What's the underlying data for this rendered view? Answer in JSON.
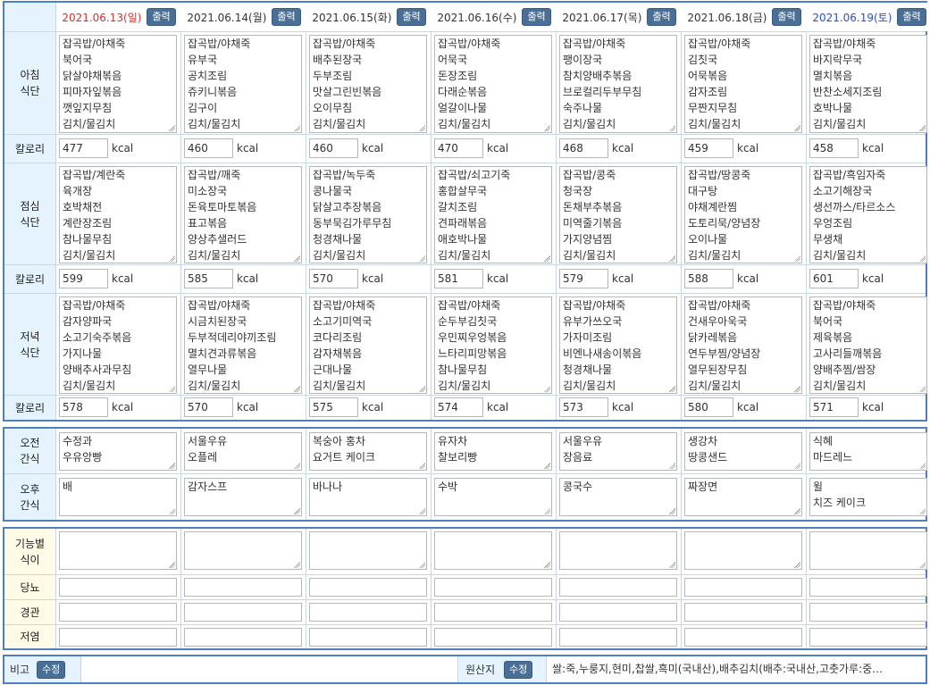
{
  "days": [
    {
      "date": "2021.06.13",
      "dow": "(일)",
      "color": "red",
      "print": "출력",
      "breakfast": "잡곡밥/야채죽\n북어국\n닭살야채볶음\n피마자잎볶음\n깻잎지무침\n김치/물김치",
      "b_kcal": "477",
      "lunch": "잡곡밥/계란죽\n육개장\n호박채전\n계란장조림\n참나물무침\n김치/물김치",
      "l_kcal": "599",
      "dinner": "잡곡밥/야채죽\n감자양파국\n소고기숙주볶음\n가지나물\n양배추사과무침\n김치/물김치",
      "d_kcal": "578",
      "am_snack": "수정과\n우유앙빵",
      "pm_snack": "배"
    },
    {
      "date": "2021.06.14",
      "dow": "(월)",
      "color": "",
      "print": "출력",
      "breakfast": "잡곡밥/야채죽\n유부국\n공치조림\n쥬키니볶음\n김구이\n김치/물김치",
      "b_kcal": "460",
      "lunch": "잡곡밥/깨죽\n미소장국\n돈육토마토볶음\n표고볶음\n양상추샐러드\n김치/물김치",
      "l_kcal": "585",
      "dinner": "잡곡밥/야채죽\n시금치된장국\n두부적데리야끼조림\n멸치견과류볶음\n열무나물\n김치/물김치",
      "d_kcal": "570",
      "am_snack": "서울우유\n오플레",
      "pm_snack": "감자스프"
    },
    {
      "date": "2021.06.15",
      "dow": "(화)",
      "color": "",
      "print": "출력",
      "breakfast": "잡곡밥/야채죽\n배추된장국\n두부조림\n맛살그린빈볶음\n오이무침\n김치/물김치",
      "b_kcal": "460",
      "lunch": "잡곡밥/녹두죽\n콩나물국\n닭살고추장볶음\n동부묵김가루무침\n청경채나물\n김치/물김치",
      "l_kcal": "570",
      "dinner": "잡곡밥/야채죽\n소고기미역국\n코다리조림\n감자채볶음\n근대나물\n김치/물김치",
      "d_kcal": "575",
      "am_snack": "복숭아 홍차\n요거트 케이크",
      "pm_snack": "바나나"
    },
    {
      "date": "2021.06.16",
      "dow": "(수)",
      "color": "",
      "print": "출력",
      "breakfast": "잡곡밥/야채죽\n어묵국\n돈장조림\n다래순볶음\n얼갈이나물\n김치/물김치",
      "b_kcal": "470",
      "lunch": "잡곡밥/쇠고기죽\n홍합살무국\n갈치조림\n견파래볶음\n애호박나물\n김치/물김치",
      "l_kcal": "581",
      "dinner": "잡곡밥/야채죽\n순두부김칫국\n우민찌우엉볶음\n느타리피망볶음\n참나물무침\n김치/물김치",
      "d_kcal": "574",
      "am_snack": "유자차\n찰보리빵",
      "pm_snack": "수박"
    },
    {
      "date": "2021.06.17",
      "dow": "(목)",
      "color": "",
      "print": "출력",
      "breakfast": "잡곡밥/야채죽\n팽이장국\n참치양배추볶음\n브로컬리두부무침\n숙주나물\n김치/물김치",
      "b_kcal": "468",
      "lunch": "잡곡밥/콩죽\n청국장\n돈채부추볶음\n미역줄기볶음\n가지양념찜\n김치/물김치",
      "l_kcal": "579",
      "dinner": "잡곡밥/야채죽\n유부가쓰오국\n가자미조림\n비엔나새송이볶음\n청경채나물\n김치/물김치",
      "d_kcal": "573",
      "am_snack": "서울우유\n장음료",
      "pm_snack": "콩국수"
    },
    {
      "date": "2021.06.18",
      "dow": "(금)",
      "color": "",
      "print": "출력",
      "breakfast": "잡곡밥/야채죽\n김칫국\n어묵볶음\n감자조림\n무짠지무침\n김치/물김치",
      "b_kcal": "459",
      "lunch": "잡곡밥/땅콩죽\n대구탕\n야채계란찜\n도토리묵/양념장\n오이나물\n김치/물김치",
      "l_kcal": "588",
      "dinner": "잡곡밥/야채죽\n건새우아욱국\n닭카레볶음\n연두부찜/양념장\n열무된장무침\n김치/물김치",
      "d_kcal": "580",
      "am_snack": "생강차\n땅콩샌드",
      "pm_snack": "짜장면"
    },
    {
      "date": "2021.06.19",
      "dow": "(토)",
      "color": "blue",
      "print": "출력",
      "breakfast": "잡곡밥/야채죽\n바지락무국\n멸치볶음\n반찬소세지조림\n호박나물\n김치/물김치",
      "b_kcal": "458",
      "lunch": "잡곡밥/흑임자죽\n소고기해장국\n생선까스/타르소스\n우엉조림\n무생채\n김치/물김치",
      "l_kcal": "601",
      "dinner": "잡곡밥/야채죽\n북어국\n제육볶음\n고사리들깨볶음\n양배추찜/쌈장\n김치/물김치",
      "d_kcal": "571",
      "am_snack": "식혜\n마드레느",
      "pm_snack": "윌\n치즈 케이크"
    }
  ],
  "labels": {
    "breakfast": "아침\n식단",
    "lunch": "점심\n식단",
    "dinner": "저녁\n식단",
    "calorie": "칼로리",
    "kcal": "kcal",
    "am_snack": "오전\n간식",
    "pm_snack": "오후\n간식",
    "functional": "기능별\n식이",
    "diabetes": "당뇨",
    "tube": "경관",
    "low_salt": "저염"
  },
  "footer": {
    "note_label": "비고",
    "note_btn": "수정",
    "origin_label": "원산지",
    "origin_btn": "수정",
    "origin_text": "쌀:죽,누룽지,현미,찹쌀,흑미(국내산),배추김치(배추:국내산,고춧가루:중…"
  },
  "colors": {
    "border": "#4f7fbf",
    "label_bg": "#e4f3fd",
    "button": "#4a6f96",
    "sunday": "#d92d2d",
    "saturday": "#2a4fc3"
  }
}
